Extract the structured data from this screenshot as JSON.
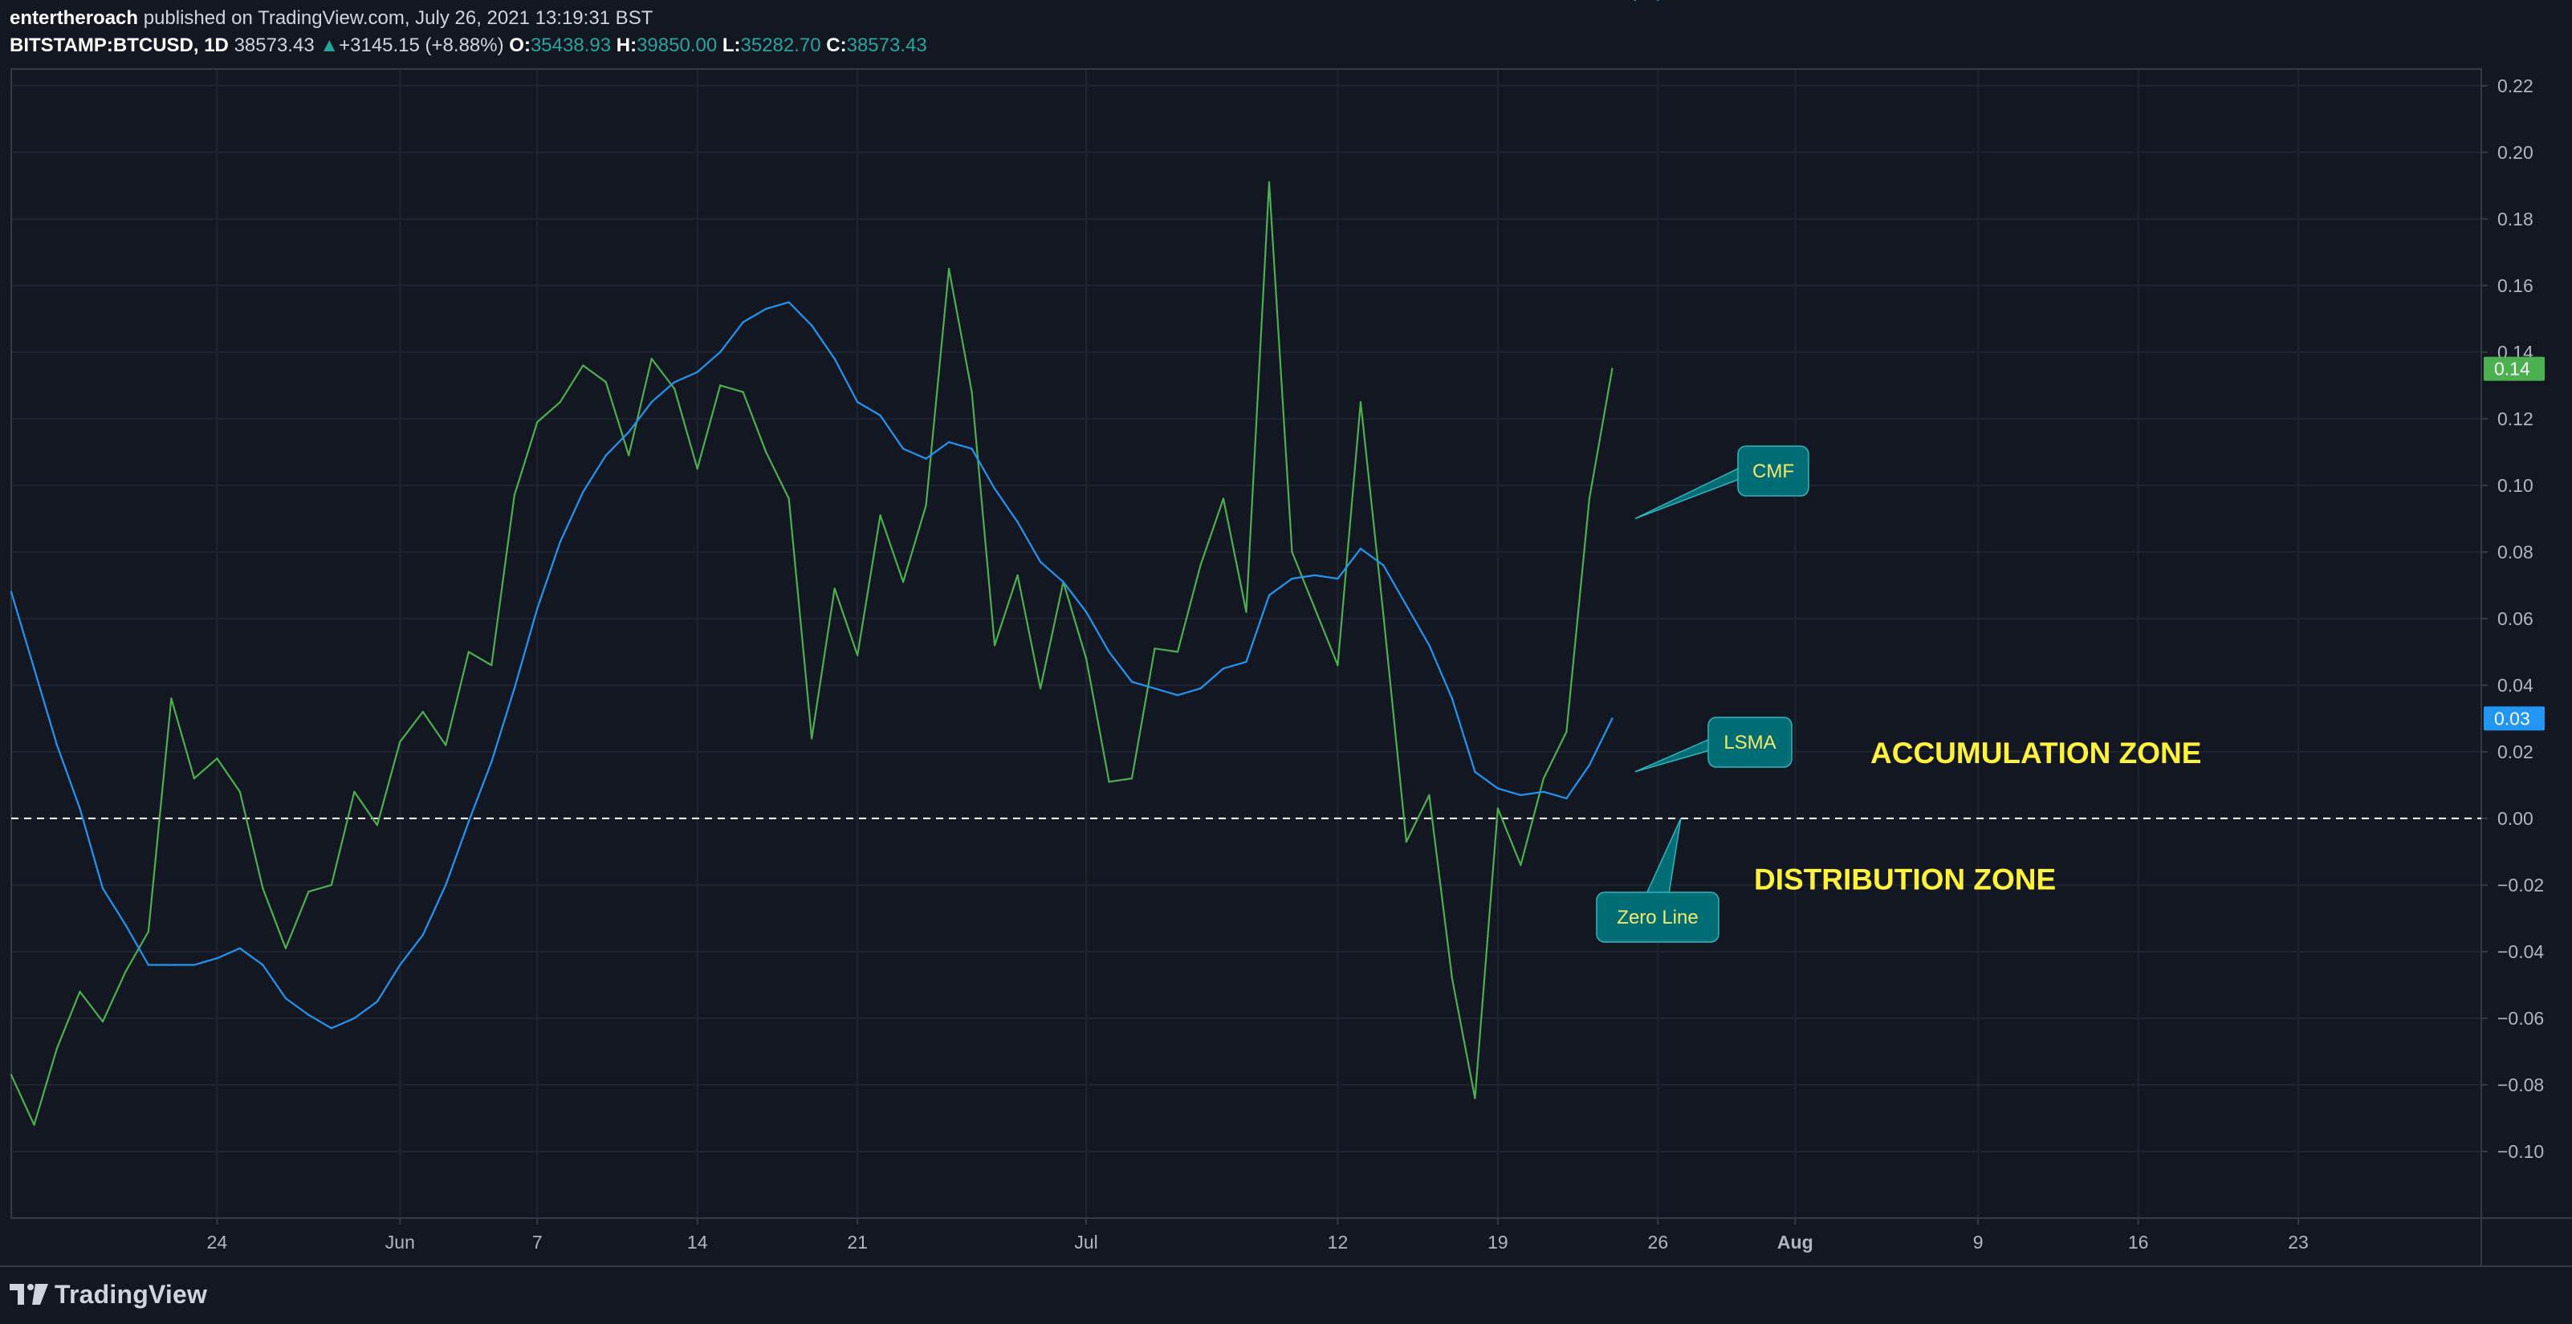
{
  "header": {
    "author": "entertheroach",
    "published_text": "published on TradingView.com, July 26, 2021 13:19:31 BST",
    "symbol": "BITSTAMP:BTCUSD, 1D",
    "price": "38573.43",
    "change_arrow": "▲",
    "change": "+3145.15 (+8.88%)",
    "open_label": "O:",
    "open_value": "35438.93",
    "high_label": "H:",
    "high_value": "39850.00",
    "low_label": "L:",
    "low_value": "35282.70",
    "close_label": "C:",
    "close_value": "38573.43"
  },
  "footer": {
    "brand": "TradingView",
    "logo_icon": "tradingview-logo-icon"
  },
  "colors": {
    "background": "#131722",
    "grid": "#1f2430",
    "axis_text": "#b2b5be",
    "cmf": "#4caf50",
    "lsma": "#2196f3",
    "zero_line": "#ffffff",
    "callout": "#006d75",
    "callout_text": "#f5e96b",
    "zone_text": "#fff23b"
  },
  "chart_data": {
    "type": "line",
    "title": "",
    "xlabel": "",
    "ylabel": "",
    "x_start": "2021-05-15",
    "x_end": "2021-08-31",
    "ylim": [
      -0.12,
      0.225
    ],
    "yticks": [
      0.22,
      0.2,
      0.18,
      0.16,
      0.14,
      0.12,
      0.1,
      0.08,
      0.06,
      0.04,
      0.02,
      0.0,
      -0.02,
      -0.04,
      -0.06,
      -0.08,
      -0.1
    ],
    "ytick_labels": [
      "0.22",
      "0.20",
      "0.18",
      "0.16",
      "0.14",
      "0.12",
      "0.10",
      "0.08",
      "0.06",
      "0.04",
      "0.02",
      "0.00",
      "−0.02",
      "−0.04",
      "−0.06",
      "−0.08",
      "−0.10"
    ],
    "xticks": [
      {
        "date": "2021-05-24",
        "label": "24",
        "bold": false
      },
      {
        "date": "2021-06-01",
        "label": "Jun",
        "bold": false
      },
      {
        "date": "2021-06-07",
        "label": "7",
        "bold": false
      },
      {
        "date": "2021-06-14",
        "label": "14",
        "bold": false
      },
      {
        "date": "2021-06-21",
        "label": "21",
        "bold": false
      },
      {
        "date": "2021-07-01",
        "label": "Jul",
        "bold": false
      },
      {
        "date": "2021-07-12",
        "label": "12",
        "bold": false
      },
      {
        "date": "2021-07-19",
        "label": "19",
        "bold": false
      },
      {
        "date": "2021-07-26",
        "label": "26",
        "bold": false
      },
      {
        "date": "2021-08-01",
        "label": "Aug",
        "bold": true
      },
      {
        "date": "2021-08-09",
        "label": "9",
        "bold": false
      },
      {
        "date": "2021-08-16",
        "label": "16",
        "bold": false
      },
      {
        "date": "2021-08-23",
        "label": "23",
        "bold": false
      }
    ],
    "grid": true,
    "zero_line": {
      "value": 0.0,
      "style": "dashed"
    },
    "series": [
      {
        "key": "cmf",
        "color": "#4caf50",
        "dates": [
          "2021-05-15",
          "2021-05-16",
          "2021-05-17",
          "2021-05-18",
          "2021-05-19",
          "2021-05-20",
          "2021-05-21",
          "2021-05-22",
          "2021-05-23",
          "2021-05-24",
          "2021-05-25",
          "2021-05-26",
          "2021-05-27",
          "2021-05-28",
          "2021-05-29",
          "2021-05-30",
          "2021-05-31",
          "2021-06-01",
          "2021-06-02",
          "2021-06-03",
          "2021-06-04",
          "2021-06-05",
          "2021-06-06",
          "2021-06-07",
          "2021-06-08",
          "2021-06-09",
          "2021-06-10",
          "2021-06-11",
          "2021-06-12",
          "2021-06-13",
          "2021-06-14",
          "2021-06-15",
          "2021-06-16",
          "2021-06-17",
          "2021-06-18",
          "2021-06-19",
          "2021-06-20",
          "2021-06-21",
          "2021-06-22",
          "2021-06-23",
          "2021-06-24",
          "2021-06-25",
          "2021-06-26",
          "2021-06-27",
          "2021-06-28",
          "2021-06-29",
          "2021-06-30",
          "2021-07-01",
          "2021-07-02",
          "2021-07-03",
          "2021-07-04",
          "2021-07-05",
          "2021-07-06",
          "2021-07-07",
          "2021-07-08",
          "2021-07-09",
          "2021-07-10",
          "2021-07-11",
          "2021-07-12",
          "2021-07-13",
          "2021-07-14",
          "2021-07-15",
          "2021-07-16",
          "2021-07-17",
          "2021-07-18",
          "2021-07-19",
          "2021-07-20",
          "2021-07-21",
          "2021-07-22",
          "2021-07-23",
          "2021-07-24",
          "2021-07-25",
          "2021-07-26"
        ],
        "values": [
          -0.077,
          -0.092,
          -0.069,
          -0.052,
          -0.061,
          -0.046,
          -0.034,
          0.036,
          0.012,
          0.018,
          0.008,
          -0.021,
          -0.039,
          -0.022,
          -0.02,
          0.008,
          -0.002,
          0.023,
          0.032,
          0.022,
          0.05,
          0.046,
          0.097,
          0.119,
          0.125,
          0.136,
          0.131,
          0.109,
          0.138,
          0.129,
          0.105,
          0.13,
          0.128,
          0.11,
          0.096,
          0.024,
          0.069,
          0.049,
          0.091,
          0.071,
          0.094,
          0.165,
          0.128,
          0.052,
          0.073,
          0.039,
          0.071,
          0.048,
          0.011,
          0.012,
          0.051,
          0.05,
          0.076,
          0.096,
          0.062,
          0.191,
          0.08,
          0.063,
          0.046,
          0.125,
          0.061,
          -0.007,
          0.007,
          -0.048,
          -0.084,
          0.003,
          -0.014,
          0.012,
          0.026,
          0.096,
          0.135
        ]
      },
      {
        "key": "lsma",
        "color": "#2196f3",
        "dates": [
          "2021-05-15",
          "2021-05-16",
          "2021-05-17",
          "2021-05-18",
          "2021-05-19",
          "2021-05-20",
          "2021-05-21",
          "2021-05-22",
          "2021-05-23",
          "2021-05-24",
          "2021-05-25",
          "2021-05-26",
          "2021-05-27",
          "2021-05-28",
          "2021-05-29",
          "2021-05-30",
          "2021-05-31",
          "2021-06-01",
          "2021-06-02",
          "2021-06-03",
          "2021-06-04",
          "2021-06-05",
          "2021-06-06",
          "2021-06-07",
          "2021-06-08",
          "2021-06-09",
          "2021-06-10",
          "2021-06-11",
          "2021-06-12",
          "2021-06-13",
          "2021-06-14",
          "2021-06-15",
          "2021-06-16",
          "2021-06-17",
          "2021-06-18",
          "2021-06-19",
          "2021-06-20",
          "2021-06-21",
          "2021-06-22",
          "2021-06-23",
          "2021-06-24",
          "2021-06-25",
          "2021-06-26",
          "2021-06-27",
          "2021-06-28",
          "2021-06-29",
          "2021-06-30",
          "2021-07-01",
          "2021-07-02",
          "2021-07-03",
          "2021-07-04",
          "2021-07-05",
          "2021-07-06",
          "2021-07-07",
          "2021-07-08",
          "2021-07-09",
          "2021-07-10",
          "2021-07-11",
          "2021-07-12",
          "2021-07-13",
          "2021-07-14",
          "2021-07-15",
          "2021-07-16",
          "2021-07-17",
          "2021-07-18",
          "2021-07-19",
          "2021-07-20",
          "2021-07-21",
          "2021-07-22",
          "2021-07-23",
          "2021-07-24",
          "2021-07-25",
          "2021-07-26"
        ],
        "values": [
          0.068,
          0.045,
          0.022,
          0.003,
          -0.021,
          -0.032,
          -0.044,
          -0.044,
          -0.044,
          -0.042,
          -0.039,
          -0.044,
          -0.054,
          -0.059,
          -0.063,
          -0.06,
          -0.055,
          -0.044,
          -0.035,
          -0.02,
          -0.001,
          0.017,
          0.039,
          0.063,
          0.083,
          0.098,
          0.109,
          0.116,
          0.125,
          0.131,
          0.134,
          0.14,
          0.149,
          0.153,
          0.155,
          0.148,
          0.138,
          0.125,
          0.121,
          0.111,
          0.108,
          0.113,
          0.111,
          0.099,
          0.089,
          0.077,
          0.071,
          0.062,
          0.05,
          0.041,
          0.039,
          0.037,
          0.039,
          0.045,
          0.047,
          0.067,
          0.072,
          0.073,
          0.072,
          0.081,
          0.076,
          0.064,
          0.052,
          0.036,
          0.014,
          0.009,
          0.007,
          0.008,
          0.006,
          0.016,
          0.03
        ]
      }
    ],
    "price_labels": [
      {
        "series": "cmf",
        "value": 0.135,
        "text": "0.14",
        "color": "#4caf50"
      },
      {
        "series": "lsma",
        "value": 0.03,
        "text": "0.03",
        "color": "#2196f3"
      }
    ],
    "annotations": [
      {
        "text": "CMF",
        "type": "callout",
        "target_date": "2021-07-25",
        "target_value": 0.09
      },
      {
        "text": "LSMA",
        "type": "callout",
        "target_date": "2021-07-25",
        "target_value": 0.014
      },
      {
        "text": "Zero Line",
        "type": "callout",
        "target_date": "2021-07-27",
        "target_value": 0.0
      },
      {
        "text": "ACCUMULATION ZONE",
        "type": "text",
        "value": 0.02
      },
      {
        "text": "DISTRIBUTION ZONE",
        "type": "text",
        "value": -0.018
      }
    ]
  }
}
